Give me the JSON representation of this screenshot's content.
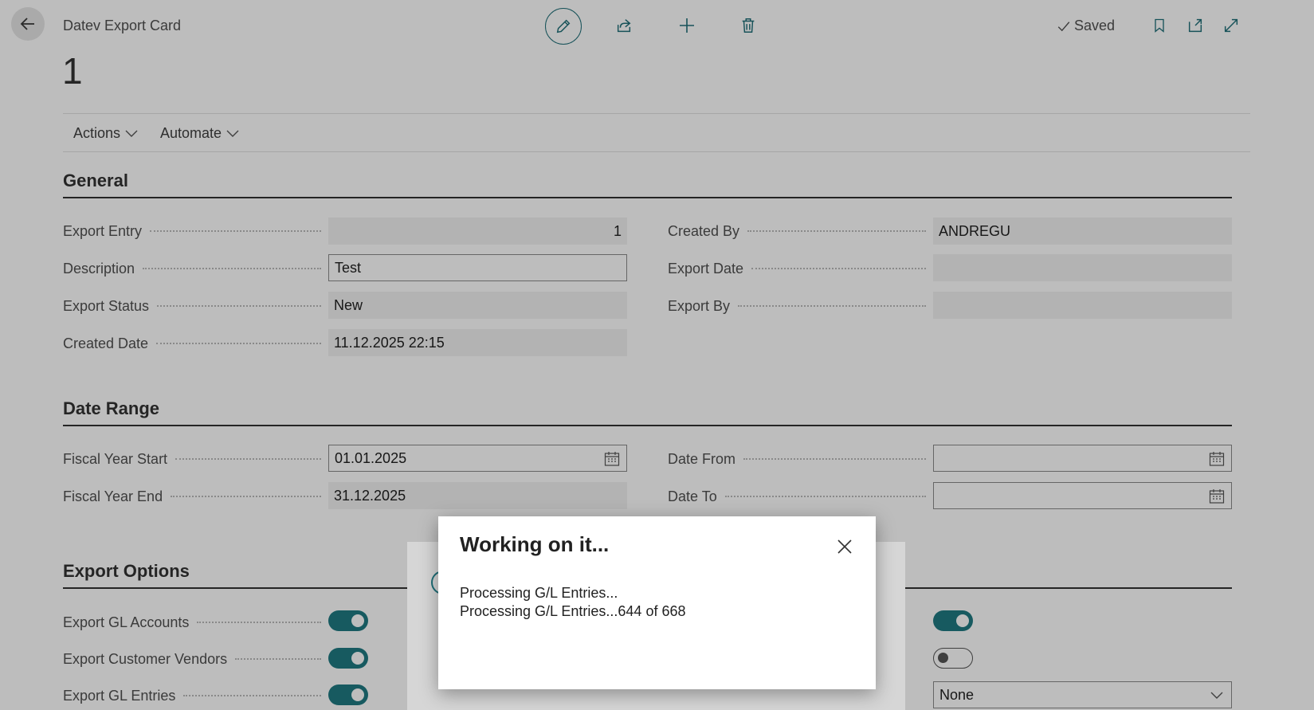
{
  "header": {
    "caption": "Datev Export Card",
    "record_no": "1",
    "status": "Saved",
    "icons": [
      "back-arrow-icon",
      "pencil-icon",
      "share-icon",
      "plus-icon",
      "trash-icon",
      "check-icon",
      "bookmark-icon",
      "open-new-window-icon",
      "expand-icon"
    ]
  },
  "actions": {
    "menu": [
      "Actions",
      "Automate"
    ]
  },
  "general": {
    "title": "General",
    "export_entry": {
      "label": "Export Entry",
      "value": "1"
    },
    "description": {
      "label": "Description",
      "value": "Test"
    },
    "export_status": {
      "label": "Export Status",
      "value": "New"
    },
    "created_date": {
      "label": "Created Date",
      "value": "11.12.2025 22:15"
    },
    "created_by": {
      "label": "Created By",
      "value": "ANDREGU"
    },
    "export_date": {
      "label": "Export Date",
      "value": ""
    },
    "export_by": {
      "label": "Export By",
      "value": ""
    }
  },
  "date_range": {
    "title": "Date Range",
    "fiscal_year_start": {
      "label": "Fiscal Year Start",
      "value": "01.01.2025"
    },
    "fiscal_year_end": {
      "label": "Fiscal Year End",
      "value": "31.12.2025"
    },
    "date_from": {
      "label": "Date From",
      "value": ""
    },
    "date_to": {
      "label": "Date To",
      "value": ""
    }
  },
  "export_options": {
    "title": "Export Options",
    "gl_accounts": {
      "label": "Export GL Accounts",
      "on": true
    },
    "customer_vendors": {
      "label": "Export Customer Vendors",
      "on": true
    },
    "gl_entries": {
      "label": "Export GL Entries",
      "on": true
    },
    "right_toggle_1": {
      "on": true
    },
    "right_toggle_2": {
      "on": false
    },
    "right_select": {
      "value": "None"
    }
  },
  "dialog": {
    "title": "Working on it...",
    "line1": "Processing G/L Entries...",
    "line2": "Processing G/L Entries...644 of 668"
  },
  "colors": {
    "accent": "#1f7a82"
  }
}
